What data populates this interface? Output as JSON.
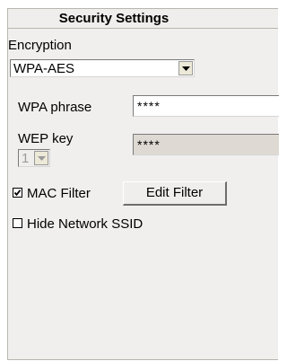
{
  "header": {
    "title": "Security Settings"
  },
  "encryption": {
    "label": "Encryption",
    "value": "WPA-AES"
  },
  "wpa": {
    "label": "WPA phrase",
    "value": "****"
  },
  "wep": {
    "label": "WEP key",
    "index_value": "1",
    "key_value": "****"
  },
  "mac_filter": {
    "label": "MAC Filter",
    "checked": true,
    "edit_button_label": "Edit Filter"
  },
  "hide_ssid": {
    "label": "Hide Network SSID",
    "checked": false
  }
}
